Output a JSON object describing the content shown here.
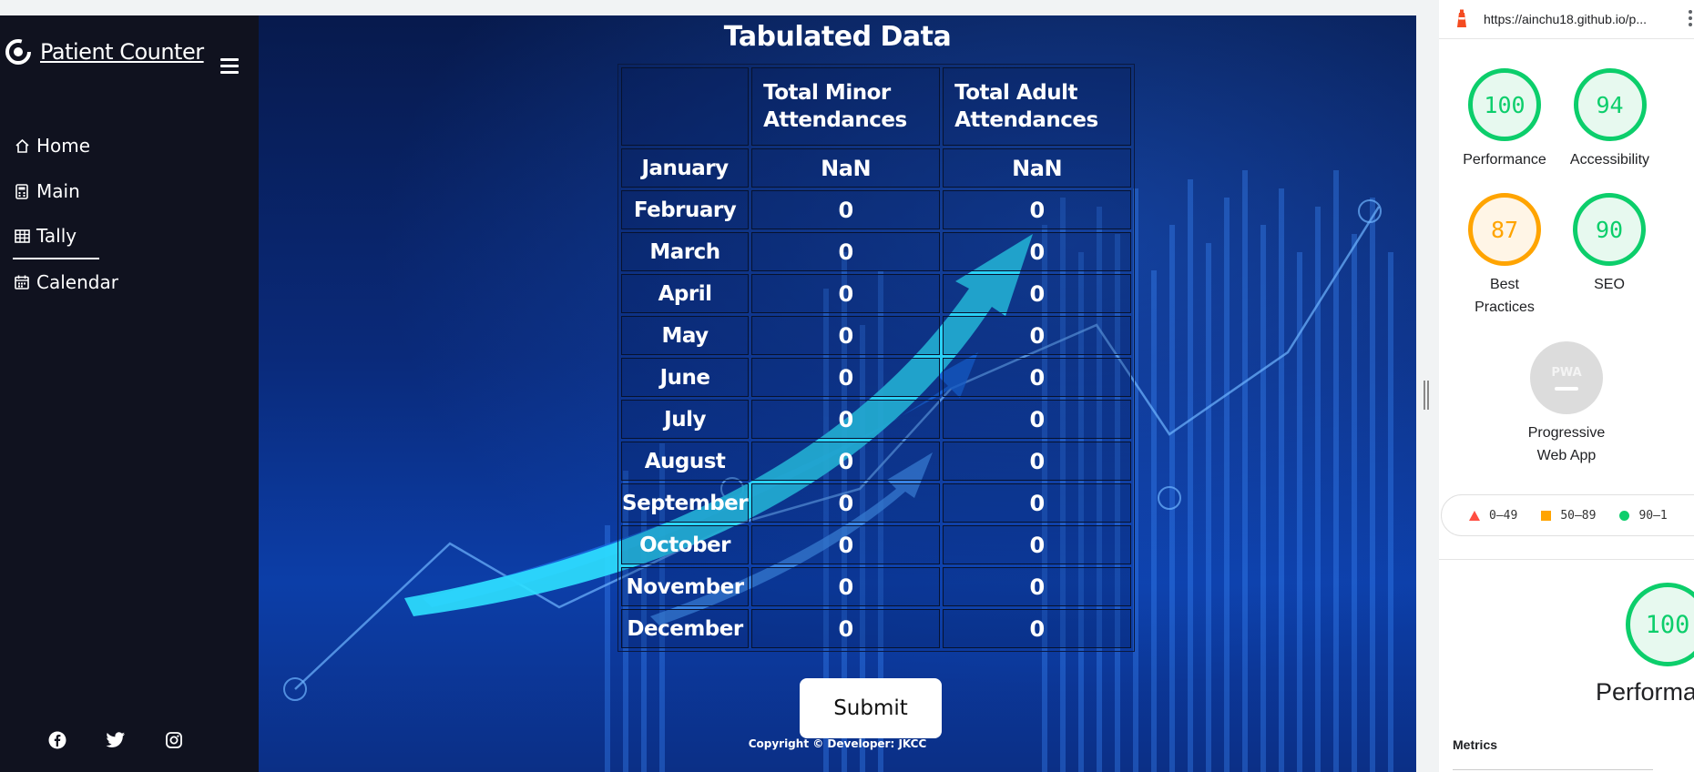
{
  "app": {
    "brand": "Patient Counter",
    "nav": [
      {
        "label": "Home",
        "icon": "home-icon"
      },
      {
        "label": "Main",
        "icon": "calculator-icon"
      },
      {
        "label": "Tally",
        "icon": "table-icon",
        "active": true
      },
      {
        "label": "Calendar",
        "icon": "calendar-icon"
      }
    ],
    "social": [
      "facebook-icon",
      "twitter-icon",
      "instagram-icon"
    ]
  },
  "main": {
    "title": "Tabulated Data",
    "table": {
      "headers": [
        "",
        "Total Minor Attendances",
        "Total Adult Attendances"
      ],
      "rows": [
        [
          "January",
          "NaN",
          "NaN"
        ],
        [
          "February",
          "0",
          "0"
        ],
        [
          "March",
          "0",
          "0"
        ],
        [
          "April",
          "0",
          "0"
        ],
        [
          "May",
          "0",
          "0"
        ],
        [
          "June",
          "0",
          "0"
        ],
        [
          "July",
          "0",
          "0"
        ],
        [
          "August",
          "0",
          "0"
        ],
        [
          "September",
          "0",
          "0"
        ],
        [
          "October",
          "0",
          "0"
        ],
        [
          "November",
          "0",
          "0"
        ],
        [
          "December",
          "0",
          "0"
        ]
      ]
    },
    "submit_label": "Submit",
    "copyright": "Copyright © Developer: JKCC"
  },
  "devtools": {
    "url": "https://ainchu18.github.io/p...",
    "scores": [
      {
        "label": "Performance",
        "score": "100",
        "status": "pass"
      },
      {
        "label": "Accessibility",
        "score": "94",
        "status": "pass"
      },
      {
        "label": "Best Practices",
        "score": "87",
        "status": "average"
      },
      {
        "label": "SEO",
        "score": "90",
        "status": "pass"
      }
    ],
    "pwa": {
      "badge": "PWA",
      "label": "Progressive Web App"
    },
    "legend": [
      {
        "range": "0–49",
        "color": "#ff4e42"
      },
      {
        "range": "50–89",
        "color": "#ffa400"
      },
      {
        "range": "90–1",
        "color": "#0cce6b"
      }
    ],
    "big_score": "100",
    "big_label": "Performa",
    "metrics_heading": "Metrics"
  },
  "colors": {
    "sidebar_bg": "#10121f",
    "pass": "#0cce6b",
    "average": "#ffa400",
    "fail": "#ff4e42"
  }
}
